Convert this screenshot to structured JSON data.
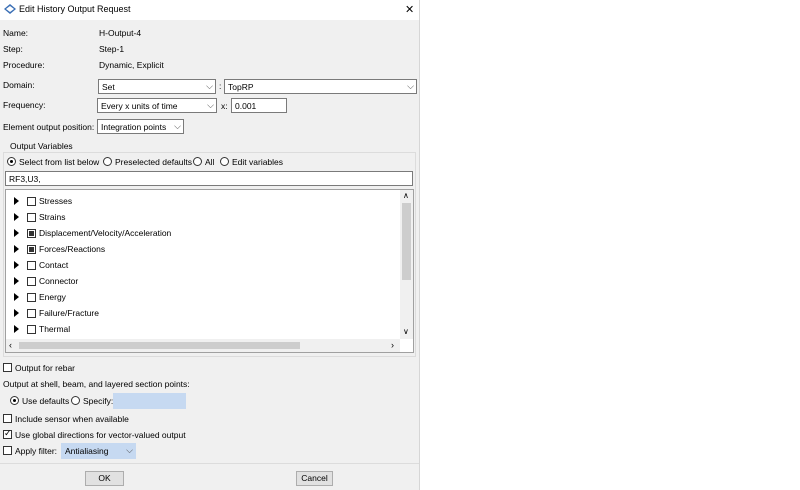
{
  "window": {
    "title": "Edit History Output Request",
    "close_glyph": "✕",
    "app_icon": "abaqus-icon"
  },
  "info": {
    "name_label": "Name:",
    "name_value": "H-Output-4",
    "step_label": "Step:",
    "step_value": "Step-1",
    "procedure_label": "Procedure:",
    "procedure_value": "Dynamic, Explicit"
  },
  "domain": {
    "label": "Domain:",
    "value": "Set",
    "separator": ":",
    "set_value": "TopRP"
  },
  "frequency": {
    "label": "Frequency:",
    "value": "Every x units of time",
    "x_label": "x:",
    "x_value": "0.001"
  },
  "element_output": {
    "label": "Element output position:",
    "value": "Integration points"
  },
  "output_variables": {
    "group_label": "Output Variables",
    "radio_options": [
      {
        "label": "Select from list below",
        "selected": true
      },
      {
        "label": "Preselected defaults",
        "selected": false
      },
      {
        "label": "All",
        "selected": false
      },
      {
        "label": "Edit variables",
        "selected": false
      }
    ],
    "text_value": "RF3,U3,",
    "items": [
      {
        "label": "Stresses",
        "state": "unchecked"
      },
      {
        "label": "Strains",
        "state": "unchecked"
      },
      {
        "label": "Displacement/Velocity/Acceleration",
        "state": "partial"
      },
      {
        "label": "Forces/Reactions",
        "state": "partial"
      },
      {
        "label": "Contact",
        "state": "unchecked"
      },
      {
        "label": "Connector",
        "state": "unchecked"
      },
      {
        "label": "Energy",
        "state": "unchecked"
      },
      {
        "label": "Failure/Fracture",
        "state": "unchecked"
      },
      {
        "label": "Thermal",
        "state": "unchecked"
      }
    ]
  },
  "rebar": {
    "label": "Output for rebar",
    "checked": false
  },
  "section_points": {
    "label": "Output at shell, beam, and layered section points:",
    "use_defaults_label": "Use defaults",
    "use_defaults_selected": true,
    "specify_label": "Specify:",
    "specify_value": ""
  },
  "sensor": {
    "label": "Include sensor when available",
    "checked": false
  },
  "global_dirs": {
    "label": "Use global directions for vector-valued output",
    "checked": true
  },
  "filter": {
    "label": "Apply filter:",
    "checked": false,
    "value": "Antialiasing"
  },
  "buttons": {
    "ok": "OK",
    "cancel": "Cancel"
  },
  "colors": {
    "dialog_bg": "#f0f0f0",
    "disabled_field": "#c6d9f1",
    "scroll_thumb": "#cdcdcd"
  }
}
